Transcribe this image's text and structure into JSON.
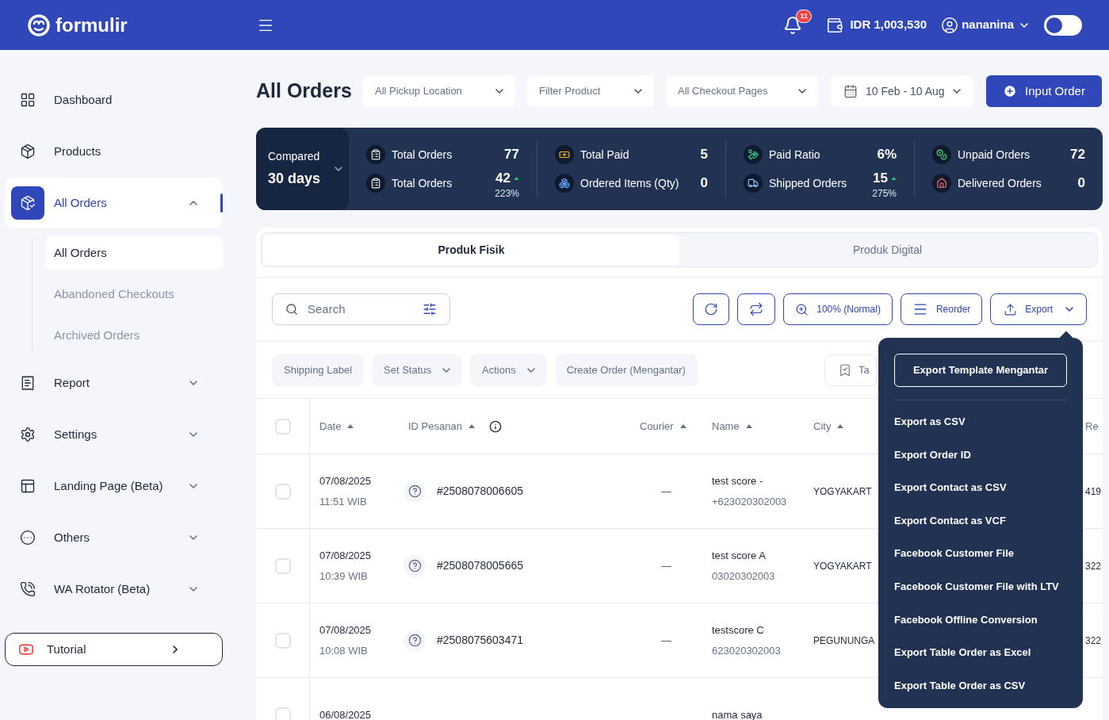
{
  "header": {
    "logo": "formulir",
    "notifications": "11",
    "balance": "IDR 1,003,530",
    "user": "nananina",
    "dark_mode": {
      "on": false
    }
  },
  "sidebar": {
    "items": [
      {
        "label": "Dashboard",
        "selected": false
      },
      {
        "label": "Products",
        "selected": false
      },
      {
        "label": "All Orders",
        "selected": true,
        "expanded": true,
        "children": [
          {
            "label": "All Orders",
            "selected": true
          },
          {
            "label": "Abandoned Checkouts",
            "selected": false
          },
          {
            "label": "Archived Orders",
            "selected": false
          }
        ]
      },
      {
        "label": "Report",
        "selected": false,
        "expanded": false
      },
      {
        "label": "Settings",
        "selected": false,
        "expanded": false
      },
      {
        "label": "Landing Page (Beta)",
        "selected": false,
        "expanded": false
      },
      {
        "label": "Others",
        "selected": false,
        "expanded": false
      },
      {
        "label": "WA Rotator (Beta)",
        "selected": false,
        "expanded": false
      }
    ],
    "tutorial": "Tutorial"
  },
  "page": {
    "title": "All Orders",
    "filters": [
      {
        "label": "All Pickup Location"
      },
      {
        "label": "Filter Product"
      },
      {
        "label": "All Checkout Pages"
      }
    ],
    "date_range": "10 Feb - 10 Aug",
    "primary_button": "Input Order"
  },
  "stats": {
    "compare_label": "Compared",
    "compare_value": "30 days",
    "groups": [
      [
        {
          "label": "Total Orders",
          "value": "77"
        },
        {
          "label": "Total Orders",
          "value": "42",
          "change": "223%"
        }
      ],
      [
        {
          "label": "Total Paid",
          "value": "5"
        },
        {
          "label": "Ordered Items (Qty)",
          "value": "0"
        }
      ],
      [
        {
          "label": "Paid Ratio",
          "value": "6%"
        },
        {
          "label": "Shipped Orders",
          "value": "15",
          "change": "275%"
        }
      ],
      [
        {
          "label": "Unpaid Orders",
          "value": "72"
        },
        {
          "label": "Delivered Orders",
          "value": "0"
        }
      ]
    ]
  },
  "tabs": [
    {
      "label": "Produk Fisik",
      "selected": true
    },
    {
      "label": "Produk Digital",
      "selected": false
    }
  ],
  "toolbar": {
    "search": {
      "placeholder": "Search"
    },
    "zoom": "100% (Normal)",
    "reorder": "Reorder",
    "export": "Export"
  },
  "actions": [
    {
      "label": "Shipping Label",
      "dropdown": false
    },
    {
      "label": "Set Status",
      "dropdown": true
    },
    {
      "label": "Actions",
      "dropdown": true
    },
    {
      "label": "Create Order (Mengantar)",
      "dropdown": false
    }
  ],
  "tag_button": "Ta",
  "table": {
    "all_selected": false,
    "columns": [
      "Date",
      "ID Pesanan",
      "Courier",
      "Name",
      "City",
      "Re"
    ],
    "rows": [
      {
        "selected": false,
        "date": "07/08/2025",
        "time": "11:51 WIB",
        "id": "#2508078006605",
        "courier": "—",
        "name": "test score -",
        "phone": "+623020302003",
        "city": "YOGYAKART",
        "column_7": "419"
      },
      {
        "selected": false,
        "date": "07/08/2025",
        "time": "10:39 WIB",
        "id": "#2508078005665",
        "courier": "—",
        "name": "test score A",
        "phone": "03020302003",
        "city": "YOGYAKART",
        "column_7": "322"
      },
      {
        "selected": false,
        "date": "07/08/2025",
        "time": "10:08 WIB",
        "id": "#2508075603471",
        "courier": "—",
        "name": "testscore C",
        "phone": "623020302003",
        "city": "PEGUNUNGA",
        "column_7": "322"
      },
      {
        "selected": false,
        "date": "06/08/2025",
        "name": "nama saya"
      }
    ]
  },
  "export_menu": [
    {
      "kind": "button",
      "label": "Export Template Mengantar"
    },
    {
      "kind": "item",
      "label": "Export as CSV"
    },
    {
      "kind": "item",
      "label": "Export Order ID"
    },
    {
      "kind": "item",
      "label": "Export Contact as CSV"
    },
    {
      "kind": "item",
      "label": "Export Contact as VCF"
    },
    {
      "kind": "item",
      "label": "Facebook Customer File"
    },
    {
      "kind": "item",
      "label": "Facebook Customer File with LTV"
    },
    {
      "kind": "item",
      "label": "Facebook Offline Conversion"
    },
    {
      "kind": "item",
      "label": "Export Table Order as Excel"
    },
    {
      "kind": "item",
      "label": "Export Table Order as CSV"
    }
  ]
}
